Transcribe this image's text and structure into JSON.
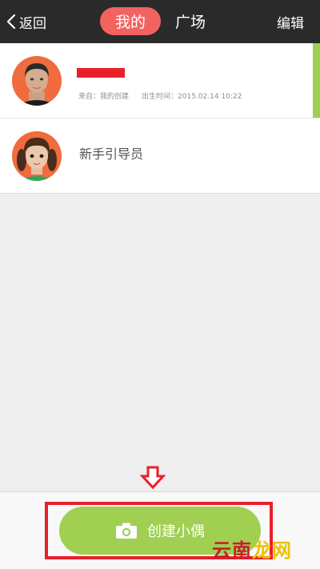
{
  "navbar": {
    "back_label": "返回",
    "tab_mine_label": "我的",
    "tab_square_label": "广场",
    "edit_label": "编辑"
  },
  "list": {
    "items": [
      {
        "name": "",
        "source_label": "来自：我的创建",
        "birth_label": "出生时间：2015.02.14 10:22"
      },
      {
        "title": "新手引导员"
      }
    ]
  },
  "bottom": {
    "create_label": "创建小偶"
  },
  "watermark": {
    "part1": "云南",
    "part2": "龙网"
  },
  "icons": {
    "back": "chevron-left-icon",
    "camera": "camera-icon",
    "arrow": "down-arrow-icon"
  },
  "colors": {
    "navbar_bg": "#2a2a2a",
    "active_tab": "#f2635f",
    "accent_green": "#a0cf52",
    "annotation_red": "#e8202a"
  }
}
